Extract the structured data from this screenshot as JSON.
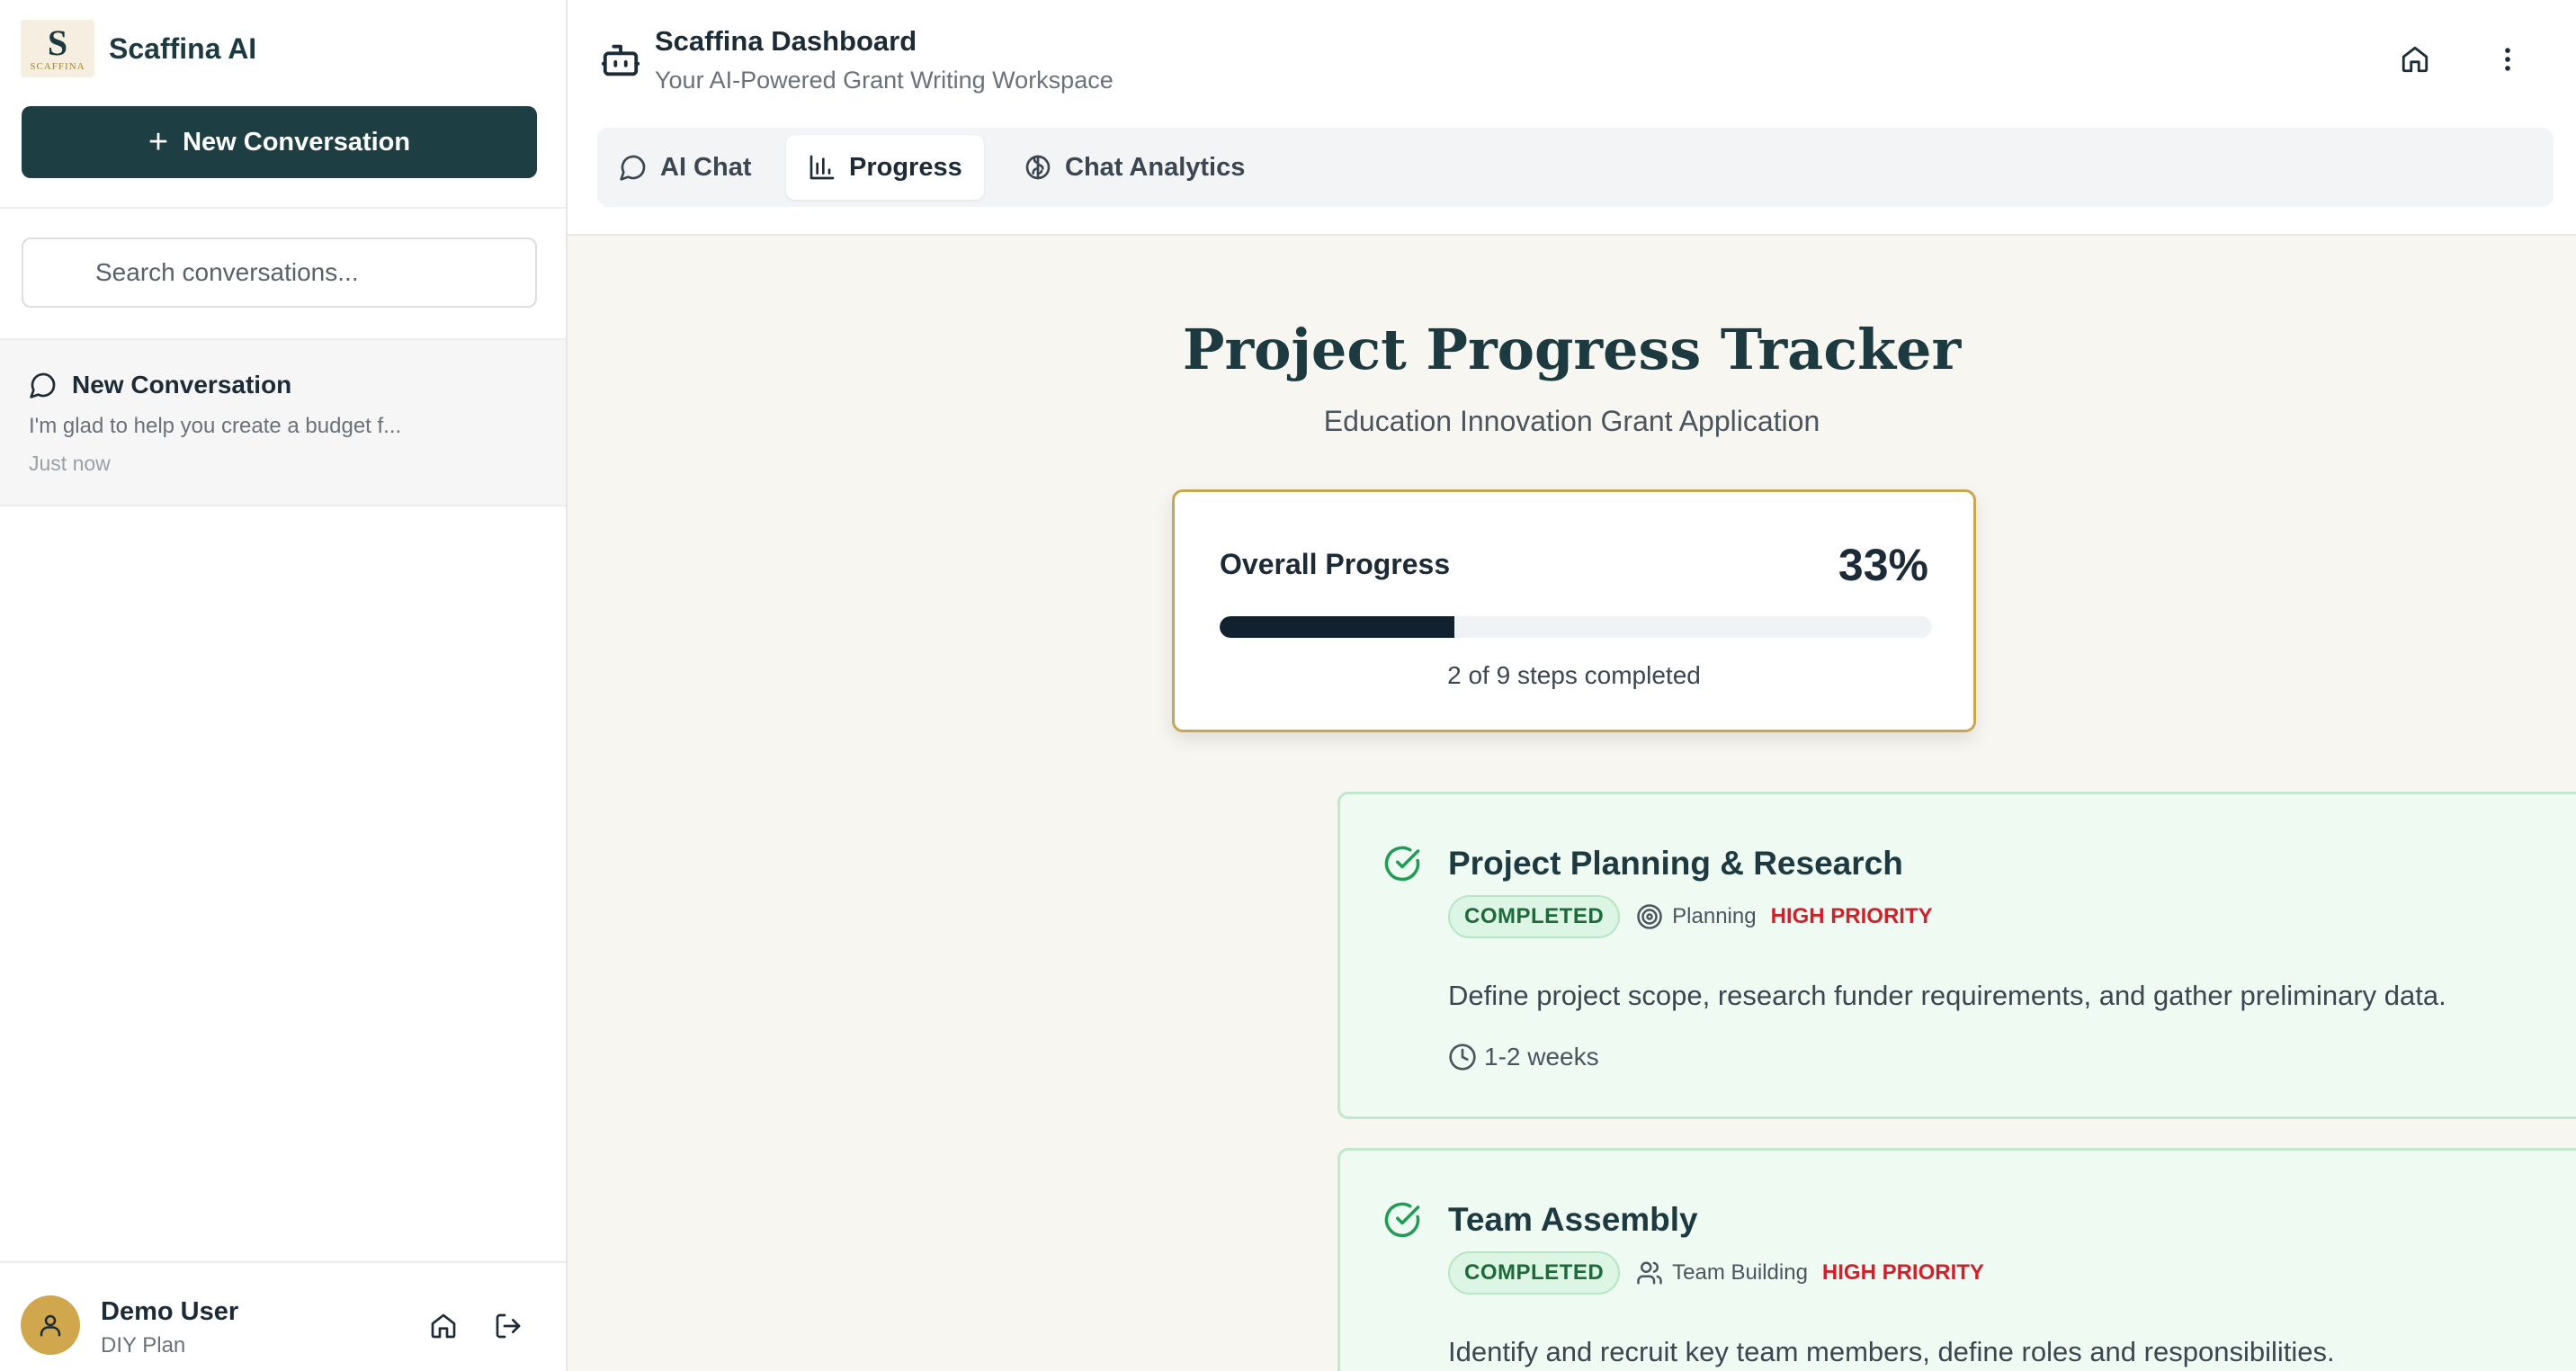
{
  "sidebar": {
    "brand_name": "Scaffina AI",
    "logo_mark": "S",
    "logo_text": "SCAFFINA",
    "new_conversation_label": "New Conversation",
    "search_placeholder": "Search conversations...",
    "conversations": [
      {
        "title": "New Conversation",
        "preview": "I'm glad to help you create a budget f...",
        "time": "Just now"
      }
    ],
    "user": {
      "name": "Demo User",
      "plan": "DIY Plan"
    }
  },
  "header": {
    "title": "Scaffina Dashboard",
    "subtitle": "Your AI-Powered Grant Writing Workspace"
  },
  "tabs": [
    {
      "label": "AI Chat",
      "icon": "chat-bubble-icon",
      "active": false
    },
    {
      "label": "Progress",
      "icon": "bar-chart-icon",
      "active": true
    },
    {
      "label": "Chat Analytics",
      "icon": "brain-icon",
      "active": false
    }
  ],
  "tracker": {
    "title": "Project Progress Tracker",
    "subtitle": "Education Innovation Grant Application",
    "overall_label": "Overall Progress",
    "percent_text": "33%",
    "percent_value": 0.33,
    "steps_text": "2 of 9 steps completed"
  },
  "steps": [
    {
      "title": "Project Planning & Research",
      "status": "COMPLETED",
      "category": "Planning",
      "category_icon": "target-icon",
      "priority": "HIGH PRIORITY",
      "description": "Define project scope, research funder requirements, and gather preliminary data.",
      "duration": "1-2 weeks"
    },
    {
      "title": "Team Assembly",
      "status": "COMPLETED",
      "category": "Team Building",
      "category_icon": "users-icon",
      "priority": "HIGH PRIORITY",
      "description": "Identify and recruit key team members, define roles and responsibilities."
    }
  ],
  "colors": {
    "brand_dark": "#1d3e43",
    "progress_fill": "#12212f",
    "card_border_gold": "#c9a750",
    "step_bg": "#effaf3",
    "priority_red": "#d1202a",
    "avatar": "#d0a74d"
  }
}
